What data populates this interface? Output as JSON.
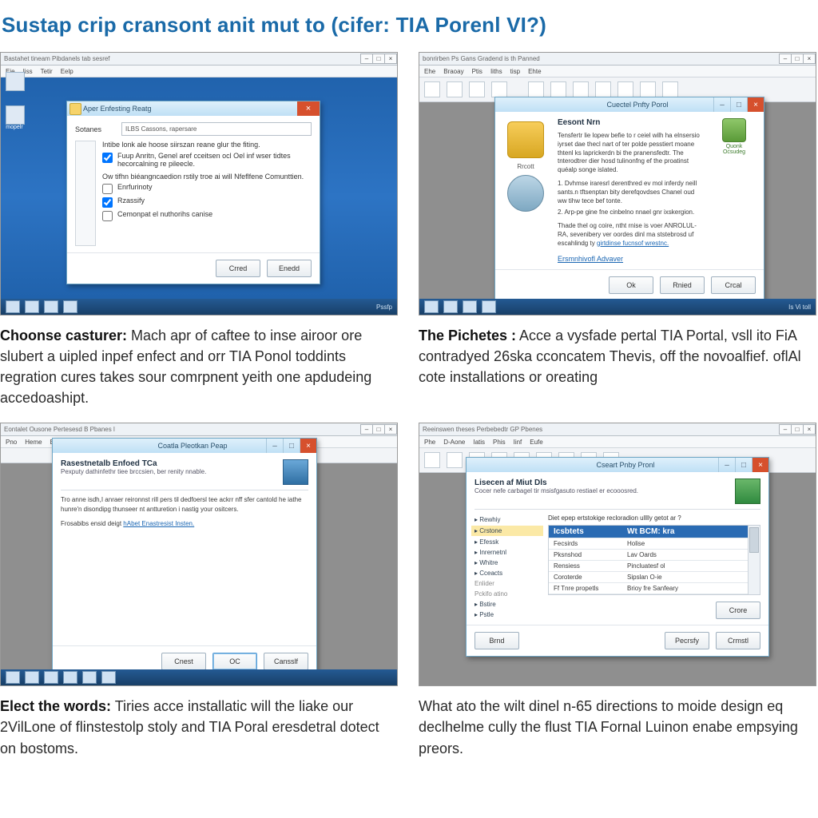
{
  "page_title": "Sustap crip cransont anit mut to (cifer: TIA Porenl VI?)",
  "panels": [
    {
      "window_title": "Bastahet tineam Pibdanels tab sesref",
      "menu": [
        "Eie",
        "Iiss",
        "Tetir",
        "Eelp"
      ],
      "taskbar_clock": "Pssfp",
      "desktop_icon_label": "mopelr",
      "dialog": {
        "title": "Aper Enfesting Reatg",
        "field_label": "Sotanes",
        "field_value": "ILBS Cassons, rapersare",
        "intro": "Intibe lonk ale hoose siirszan reane glur the fiting.",
        "chk1": "Fuup Anritn, Genel aref cceitsen ocl Oel inf wser tidtes hecorcalning re pileecle.",
        "section": "Ow tifhn biéangncaedion rstily troe ai will Nfeflfene Comunttien.",
        "chk2": "Enrfurinoty",
        "chk3": "Rzassify",
        "chk4": "Cemonpat el nuthorihs canise",
        "btn_cancel": "Crred",
        "btn_ok": "Enedd"
      },
      "caption_bold": "Choonse casturer:",
      "caption_rest": " Mach apr of caftee to inse airoor ore slubert a uipled inpef enfect and orr TIA Ponol toddints regration cures takes sour comrpnent yeith one apdudeing accedoashipt."
    },
    {
      "window_title": "bonrirben Ps Gans Gradend is th Panned",
      "menu": [
        "Ehe",
        "Braoay",
        "Ptis",
        "Iiths",
        "tisp",
        "Ehte"
      ],
      "taskbar_clock": "Is Vi toll",
      "dialog": {
        "title": "Cuectel Pnfty Porol",
        "head": "Eesont Nrn",
        "icon1_label": "Rrcott",
        "icon2_label": "",
        "body1": "Tensfertr lie lopew befie to r ceiel wilh ha elnsersio iyrset dae thecl nart of ter polde pesstiert moane thtenl ks laprickerdn bi the pranensfedtr. The tnterodtrer dier hosd tulinonfng ef the proatinst quéalp songe islated.",
        "li1": "1.  Dvhmse iraresrl derenthred ev mol inferdy neill sants.n tftsenptan bity derefqovdses Chanel oud ww tihw tece bef tonte.",
        "li2": "2.  Arp-pe gine fne cinbelno nnael gnr ixskergion.",
        "body2": "Thade thel og coire, ntht rnise is voer ANROLUL-RA, sevenibery ver oordes dinl ma ststebrosd uf escahlindg ty",
        "link1": "girtdinse fucnsof wrestnc.",
        "link2": "Ersmnhivofl Advaver",
        "btn_ok": "Ok",
        "btn_next": "Rnied",
        "btn_cancel": "Crcal"
      },
      "caption_bold": "The Pichetes :",
      "caption_rest": " Acce a vysfade pertal TIA Portal, vsll ito FiA contradyed 26ska cconcatem Thevis, off the novoalfief. oflAl cote installations or oreating"
    },
    {
      "window_title": "Eontalet Ousone Pertesesd B Pbanes l",
      "menu": [
        "Pno",
        "Heme",
        "Ehe"
      ],
      "taskbar_clock": "",
      "dialog": {
        "title": "Coatla Pleotkan Peap",
        "head": "Rasestnetalb Enfoed TCa",
        "sub": "Pexputy dathinfethr tiee brccsien, ber renity nnable.",
        "body": "Tro anne isdh,I anraer reironnst rill pers til dedfoersl tee ackrr nff sfer cantold he iathe hunre'n disondipg thunseer nt antturetion i nastig your ositcers.",
        "linklabel": "Frosabibs ensid deigt",
        "link": "hAbet Enastresist Insten.",
        "btn_cancel": "Cnest",
        "btn_ok": "OC",
        "btn_close": "Cansslf"
      },
      "caption_bold": "Elect the words:",
      "caption_rest": " Tiries acce installatic will the liake our 2VilLone of flinstestolp stoly and TIA Poral eresdetral dotect on bostoms."
    },
    {
      "window_title": "Reeinswen theses Perbebedtr GP Pbenes",
      "menu": [
        "Phe",
        "D-Aone",
        "Iatis",
        "Phis",
        "Iinf",
        "Eufe"
      ],
      "dialog": {
        "title": "Cseart Pnby Pronl",
        "head": "Lisecen af Miut Dls",
        "sub": "Cocer nefe carbagel tir msisfgasuto restiael er ecooosred.",
        "side": [
          "Rewhiy",
          "Crstone",
          "Efessk",
          "Inrernetnl",
          "Whitre",
          "Cceacts",
          "Enlider",
          "Pckifo atino",
          "Bstire",
          "Pstle"
        ],
        "prompt": "Diet epep ertstokige recloradion ulllly getot ar ?",
        "rows": [
          [
            "Icsbtets",
            "Wt BCM: kra"
          ],
          [
            "Fecsirds",
            "Holise"
          ],
          [
            "Pksnshod",
            "Lav Oards"
          ],
          [
            "Rensiess",
            "Pincluatesf ol"
          ],
          [
            "Coroterde",
            "Sipslan O-ie"
          ],
          [
            "Ff Tnre propetls",
            "Brioy fre Sanfeary"
          ]
        ],
        "btn_side": "Crore",
        "btn_back": "Brnd",
        "btn_next": "Pecrsfy",
        "btn_cancel": "Crmstl"
      },
      "caption_bold": "",
      "caption_rest": "What ato the wilt dinel n-65 directions to moide design eq declhelme cully the flust TIA Fornal Luinon enabe empsying preors."
    }
  ]
}
